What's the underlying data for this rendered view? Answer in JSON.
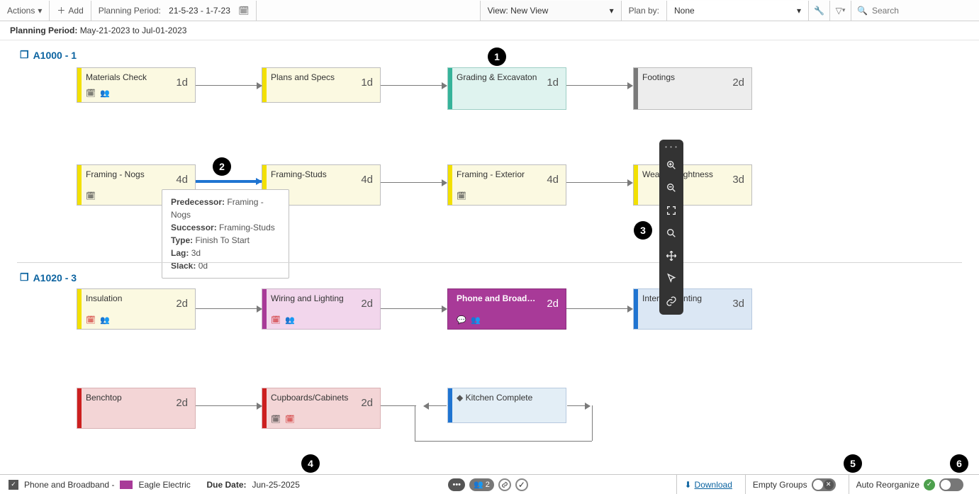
{
  "toolbar": {
    "actions": "Actions",
    "add": "Add",
    "pp_label": "Planning Period:",
    "pp_value": "21-5-23 - 1-7-23",
    "view_label": "View:",
    "view_value": "New View",
    "planby_label": "Plan by:",
    "planby_value": "None",
    "search_ph": "Search"
  },
  "subheader": {
    "label": "Planning Period:",
    "range": "May-21-2023 to Jul-01-2023"
  },
  "groups": {
    "g1": "A1000 - 1",
    "g2": "A1020 - 3"
  },
  "nodes": {
    "n1": {
      "title": "Materials Check",
      "dur": "1d"
    },
    "n2": {
      "title": "Plans and Specs",
      "dur": "1d"
    },
    "n3": {
      "title": "Grading & Excavaton",
      "dur": "1d"
    },
    "n4": {
      "title": "Footings",
      "dur": "2d"
    },
    "n5": {
      "title": "Framing - Nogs",
      "dur": "4d"
    },
    "n6": {
      "title": "Framing-Studs",
      "dur": "4d"
    },
    "n7": {
      "title": "Framing - Exterior",
      "dur": "4d"
    },
    "n8": {
      "title": "Weather Tightness",
      "dur": "3d"
    },
    "n9": {
      "title": "Insulation",
      "dur": "2d"
    },
    "n10": {
      "title": "Wiring and Lighting",
      "dur": "2d"
    },
    "n11": {
      "title": "Phone and Broadba...",
      "dur": "2d"
    },
    "n12": {
      "title": "Interior Painting",
      "dur": "3d"
    },
    "n13": {
      "title": "Benchtop",
      "dur": "2d"
    },
    "n14": {
      "title": "Cupboards/Cabinets",
      "dur": "2d"
    },
    "n15": {
      "title": "Kitchen Complete",
      "dur": ""
    }
  },
  "popup": {
    "pred_l": "Predecessor:",
    "pred_v": "Framing - Nogs",
    "succ_l": "Successor:",
    "succ_v": "Framing-Studs",
    "type_l": "Type:",
    "type_v": "Finish To Start",
    "lag_l": "Lag:",
    "lag_v": "3d",
    "slack_l": "Slack:",
    "slack_v": "0d"
  },
  "status": {
    "check": "Phone and Broadband  -",
    "contractor": "Eagle Electric",
    "due_l": "Due Date:",
    "due_v": "Jun-25-2025",
    "badge_count": "2",
    "download": "Download",
    "empty": "Empty Groups",
    "auto": "Auto Reorganize"
  },
  "callouts": {
    "c1": "1",
    "c2": "2",
    "c3": "3",
    "c4": "4",
    "c5": "5",
    "c6": "6"
  }
}
